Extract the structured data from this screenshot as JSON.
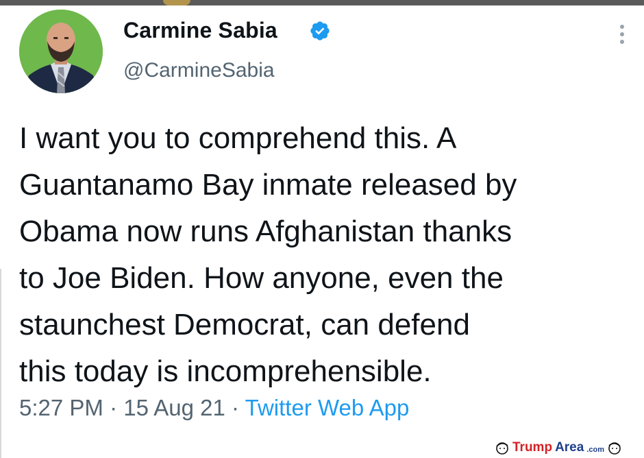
{
  "tweet": {
    "display_name": "Carmine Sabia",
    "handle": "@CarmineSabia",
    "verified": true,
    "avatar_icon": "profile-photo",
    "more_icon": "vertical-ellipsis-icon",
    "text_lines": [
      "I want you to comprehend this. A",
      "Guantanamo Bay inmate released by",
      "Obama now runs Afghanistan thanks",
      "to Joe Biden. How anyone, even the",
      "staunchest Democrat, can defend",
      "this today is incomprehensible."
    ],
    "time": "5:27 PM",
    "separator": " · ",
    "date": "15 Aug 21",
    "source": "Twitter Web App"
  },
  "watermark": {
    "brand_trump": "Trump",
    "brand_area": "Area",
    "brand_com": ".com"
  },
  "colors": {
    "text": "#0f1419",
    "secondary": "#536471",
    "link": "#1d9bf0",
    "verified": "#1d9bf0",
    "avatar_bg": "#6fb84c",
    "watermark_red": "#d42126",
    "watermark_blue": "#1f3f8a"
  }
}
